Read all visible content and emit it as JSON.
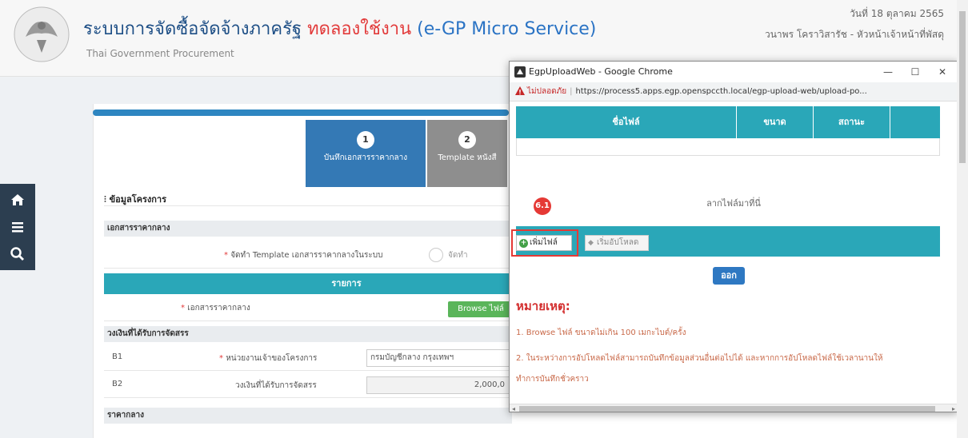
{
  "header": {
    "title_main": "ระบบการจัดซื้อจัดจ้างภาครัฐ",
    "title_trial": "ทดลองใช้งาน",
    "title_micro": "(e-GP Micro Service)",
    "subtitle": "Thai Government Procurement",
    "date": "วันที่ 18 ตุลาคม 2565",
    "user": "วนาพร โคราวิสารัช - หัวหน้าเจ้าหน้าที่พัสดุ"
  },
  "steps": [
    {
      "num": "1",
      "label": "บันทึกเอกสารราคากลาง"
    },
    {
      "num": "2",
      "label": "Template หนังสื"
    }
  ],
  "form": {
    "section_project": "ข้อมูลโครงการ",
    "section_ref_docs": "เอกสารราคากลาง",
    "template_label": "จัดทำ Template เอกสารราคากลางในระบบ",
    "template_option": "จัดทำ",
    "list_header": "รายการ",
    "ref_doc_label": "เอกสารราคากลาง",
    "browse_label": "Browse ไฟล์",
    "section_budget": "วงเงินที่ได้รับการจัดสรร",
    "b1_code": "B1",
    "b1_label": "หน่วยงานเจ้าของโครงการ",
    "b1_value": "กรมบัญชีกลาง กรุงเทพฯ",
    "b2_code": "B2",
    "b2_label": "วงเงินที่ได้รับการจัดสรร",
    "b2_value": "2,000,0",
    "section_price": "ราคากลาง"
  },
  "popup": {
    "window_title": "EgpUploadWeb - Google Chrome",
    "minimize": "—",
    "maximize": "☐",
    "close": "✕",
    "insecure_label": "ไม่ปลอดภัย",
    "url": "https://process5.apps.egp.openspccth.local/egp-upload-web/upload-po...",
    "columns": [
      "ชื่อไฟล์",
      "ขนาด",
      "สถานะ"
    ],
    "drop_text": "ลากไฟล์มาที่นี่",
    "badge": "6.1",
    "add_file_label": "เพิ่มไฟล์",
    "start_upload_label": "เริ่มอัปโหลด",
    "exit_label": "ออก",
    "note_title": "หมายเหตุ:",
    "notes": [
      "1. Browse ไฟล์ ขนาดไม่เกิน 100 เมกะไบต์/ครั้ง",
      "2. ในระหว่างการอัปโหลดไฟล์สามารถบันทึกข้อมูลส่วนอื่นต่อไปได้ และหากการอัปโหลดไฟล์ใช้เวลานานให้",
      "ทำการบันทึกชั่วคราว"
    ]
  },
  "colors": {
    "primary": "#3479b5",
    "teal": "#2aa7b8",
    "alert": "#e53935"
  },
  "icons": [
    "home-icon",
    "menu-icon",
    "search-icon",
    "chrome-icon",
    "warning-icon",
    "add-icon",
    "upload-icon"
  ]
}
